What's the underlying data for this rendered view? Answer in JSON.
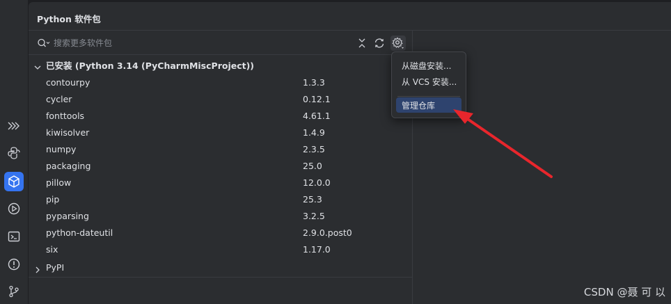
{
  "window": {
    "title": "Python 软件包"
  },
  "search": {
    "placeholder": "搜索更多软件包"
  },
  "installed_group": {
    "label": "已安装 (Python 3.14 (PyCharmMiscProject))"
  },
  "packages": [
    {
      "name": "contourpy",
      "version": "1.3.3"
    },
    {
      "name": "cycler",
      "version": "0.12.1"
    },
    {
      "name": "fonttools",
      "version": "4.61.1"
    },
    {
      "name": "kiwisolver",
      "version": "1.4.9"
    },
    {
      "name": "numpy",
      "version": "2.3.5"
    },
    {
      "name": "packaging",
      "version": "25.0"
    },
    {
      "name": "pillow",
      "version": "12.0.0"
    },
    {
      "name": "pip",
      "version": "25.3"
    },
    {
      "name": "pyparsing",
      "version": "3.2.5"
    },
    {
      "name": "python-dateutil",
      "version": "2.9.0.post0"
    },
    {
      "name": "six",
      "version": "1.17.0"
    }
  ],
  "pypi_group": {
    "label": "PyPI"
  },
  "menu": {
    "items": [
      {
        "label": "从磁盘安装..."
      },
      {
        "label": "从 VCS 安装..."
      },
      {
        "label": "管理仓库"
      }
    ]
  },
  "watermark": {
    "text": "CSDN @聂 可 以"
  },
  "colors": {
    "background": "#1e1f22",
    "panel": "#2b2d30",
    "accent": "#3574f0",
    "selected_menu": "#2e436e",
    "annotation_arrow": "#e8262c"
  },
  "icons": [
    "expand-icon",
    "python-icon",
    "python-packages-icon",
    "run-icon",
    "terminal-icon",
    "problems-icon",
    "git-icon",
    "search-icon",
    "collapse-all-icon",
    "refresh-icon",
    "settings-icon",
    "chevron-down-icon",
    "chevron-right-icon"
  ]
}
